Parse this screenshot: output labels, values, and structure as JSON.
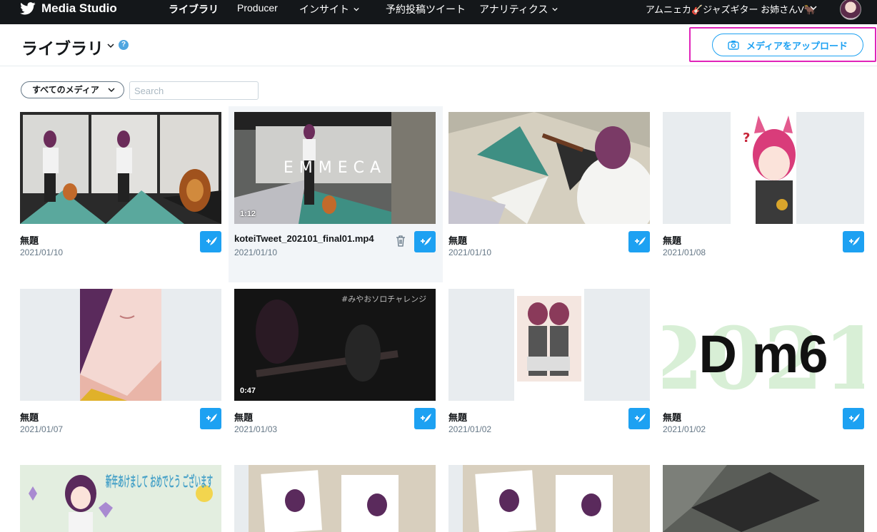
{
  "topnav": {
    "brand": "Media Studio",
    "items": [
      {
        "label": "ライブラリ"
      },
      {
        "label": "Producer"
      },
      {
        "label": "インサイト"
      },
      {
        "label": "予約投稿ツイート"
      },
      {
        "label": "アナリティクス"
      }
    ],
    "account": "アムニェカ🎸ジャズギター お姉さんV🐂"
  },
  "header": {
    "title": "ライブラリ",
    "help": "?",
    "upload_label": "メディアをアップロード"
  },
  "filters": {
    "media_filter": "すべてのメディア",
    "search_placeholder": "Search"
  },
  "cards": [
    {
      "title": "無題",
      "date": "2021/01/10",
      "duration": ""
    },
    {
      "title": "koteiTweet_202101_final01.mp4",
      "date": "2021/01/10",
      "duration": "1:12"
    },
    {
      "title": "無題",
      "date": "2021/01/10",
      "duration": ""
    },
    {
      "title": "無題",
      "date": "2021/01/08",
      "duration": ""
    },
    {
      "title": "無題",
      "date": "2021/01/07",
      "duration": ""
    },
    {
      "title": "無題",
      "date": "2021/01/03",
      "duration": "0:47"
    },
    {
      "title": "無題",
      "date": "2021/01/02",
      "duration": ""
    },
    {
      "title": "無題",
      "date": "2021/01/02",
      "duration": ""
    }
  ],
  "thumb_text": {
    "emmeca": "EMMECA",
    "solo": "#みやおソロチャレンジ",
    "chord": "D m6",
    "year": "2021",
    "newyear": "新年あけまして おめでとう ございます"
  },
  "colors": {
    "accent": "#1da1f2",
    "nav_bg": "#14171a",
    "highlight": "#e023b9"
  }
}
